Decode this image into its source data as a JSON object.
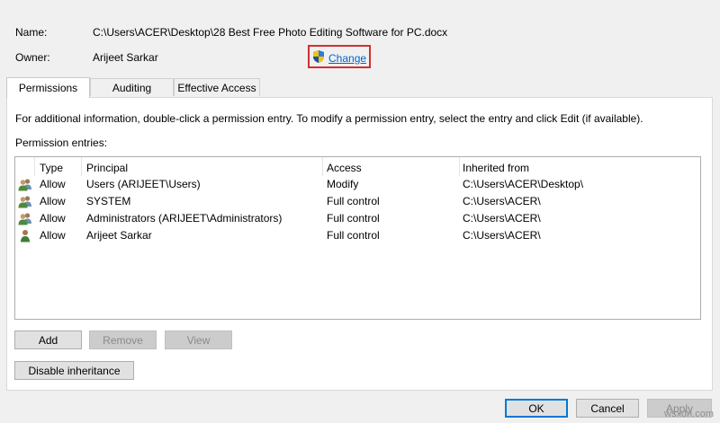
{
  "header": {
    "name_label": "Name:",
    "name_value": "C:\\Users\\ACER\\Desktop\\28 Best Free Photo Editing Software for PC.docx",
    "owner_label": "Owner:",
    "owner_value": "Arijeet Sarkar",
    "change_link": "Change"
  },
  "tabs": [
    {
      "label": "Permissions",
      "active": true
    },
    {
      "label": "Auditing",
      "active": false
    },
    {
      "label": "Effective Access",
      "active": false
    }
  ],
  "permissions": {
    "info_text": "For additional information, double-click a permission entry. To modify a permission entry, select the entry and click Edit (if available).",
    "entries_label": "Permission entries:",
    "columns": [
      "Type",
      "Principal",
      "Access",
      "Inherited from"
    ],
    "rows": [
      {
        "icon": "group-icon",
        "type": "Allow",
        "principal": "Users (ARIJEET\\Users)",
        "access": "Modify",
        "inherited_from": "C:\\Users\\ACER\\Desktop\\"
      },
      {
        "icon": "group-icon",
        "type": "Allow",
        "principal": "SYSTEM",
        "access": "Full control",
        "inherited_from": "C:\\Users\\ACER\\"
      },
      {
        "icon": "group-icon",
        "type": "Allow",
        "principal": "Administrators (ARIJEET\\Administrators)",
        "access": "Full control",
        "inherited_from": "C:\\Users\\ACER\\"
      },
      {
        "icon": "user-icon",
        "type": "Allow",
        "principal": "Arijeet Sarkar",
        "access": "Full control",
        "inherited_from": "C:\\Users\\ACER\\"
      }
    ],
    "buttons": {
      "add": "Add",
      "remove": "Remove",
      "view": "View",
      "disable_inheritance": "Disable inheritance"
    }
  },
  "footer": {
    "ok": "OK",
    "cancel": "Cancel",
    "apply": "Apply"
  },
  "watermark": "wsxdn.com"
}
